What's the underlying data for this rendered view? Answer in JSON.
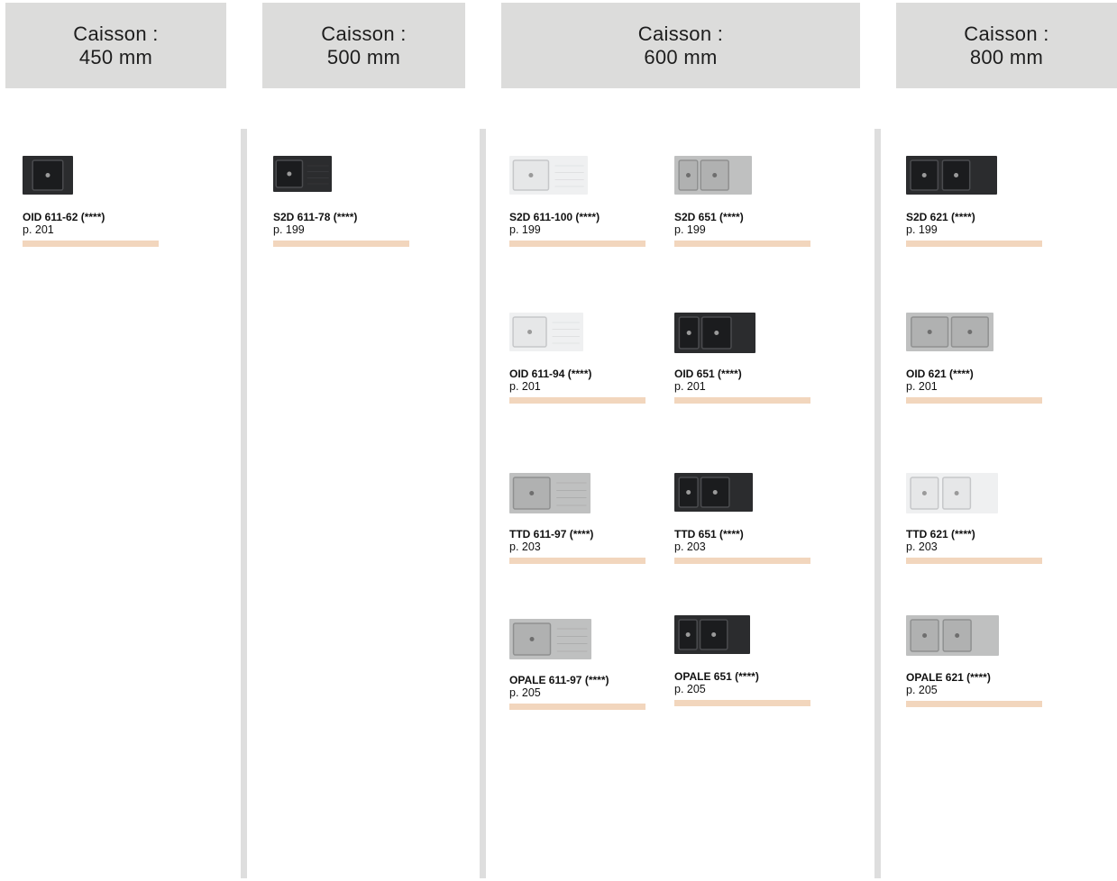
{
  "colors": {
    "header_bg": "#dcdcdb",
    "divider": "#dedede",
    "accent_bar": "#f2d6bd"
  },
  "headers": [
    {
      "label": "Caisson :",
      "size": "450 mm"
    },
    {
      "label": "Caisson :",
      "size": "500 mm"
    },
    {
      "label": "Caisson :",
      "size": "600 mm"
    },
    {
      "label": "Caisson :",
      "size": "800 mm"
    }
  ],
  "products": [
    {
      "name": "OID 611-62 (****)",
      "page": "p. 201",
      "color": "black",
      "bowls": "single"
    },
    {
      "name": "S2D 611-78 (****)",
      "page": "p. 199",
      "color": "black",
      "bowls": "single-drainer"
    },
    {
      "name": "S2D 611-100 (****)",
      "page": "p. 199",
      "color": "white",
      "bowls": "single-drainer"
    },
    {
      "name": "S2D 651 (****)",
      "page": "p. 199",
      "color": "grey",
      "bowls": "one-and-half-drainer"
    },
    {
      "name": "S2D 621 (****)",
      "page": "p. 199",
      "color": "black",
      "bowls": "double-drainer"
    },
    {
      "name": "OID 611-94 (****)",
      "page": "p. 201",
      "color": "white",
      "bowls": "single-drainer"
    },
    {
      "name": "OID 651 (****)",
      "page": "p. 201",
      "color": "black",
      "bowls": "one-and-half-drainer"
    },
    {
      "name": "OID 621 (****)",
      "page": "p. 201",
      "color": "grey",
      "bowls": "double"
    },
    {
      "name": "TTD 611-97 (****)",
      "page": "p. 203",
      "color": "grey",
      "bowls": "single-drainer"
    },
    {
      "name": "TTD 651 (****)",
      "page": "p. 203",
      "color": "black",
      "bowls": "one-and-half-drainer"
    },
    {
      "name": "TTD 621 (****)",
      "page": "p. 203",
      "color": "white",
      "bowls": "double-drainer"
    },
    {
      "name": "OPALE 611-97 (****)",
      "page": "p. 205",
      "color": "grey",
      "bowls": "single-drainer"
    },
    {
      "name": "OPALE 651 (****)",
      "page": "p. 205",
      "color": "black",
      "bowls": "one-and-half-drainer"
    },
    {
      "name": "OPALE 621 (****)",
      "page": "p. 205",
      "color": "grey",
      "bowls": "double-drainer"
    }
  ]
}
